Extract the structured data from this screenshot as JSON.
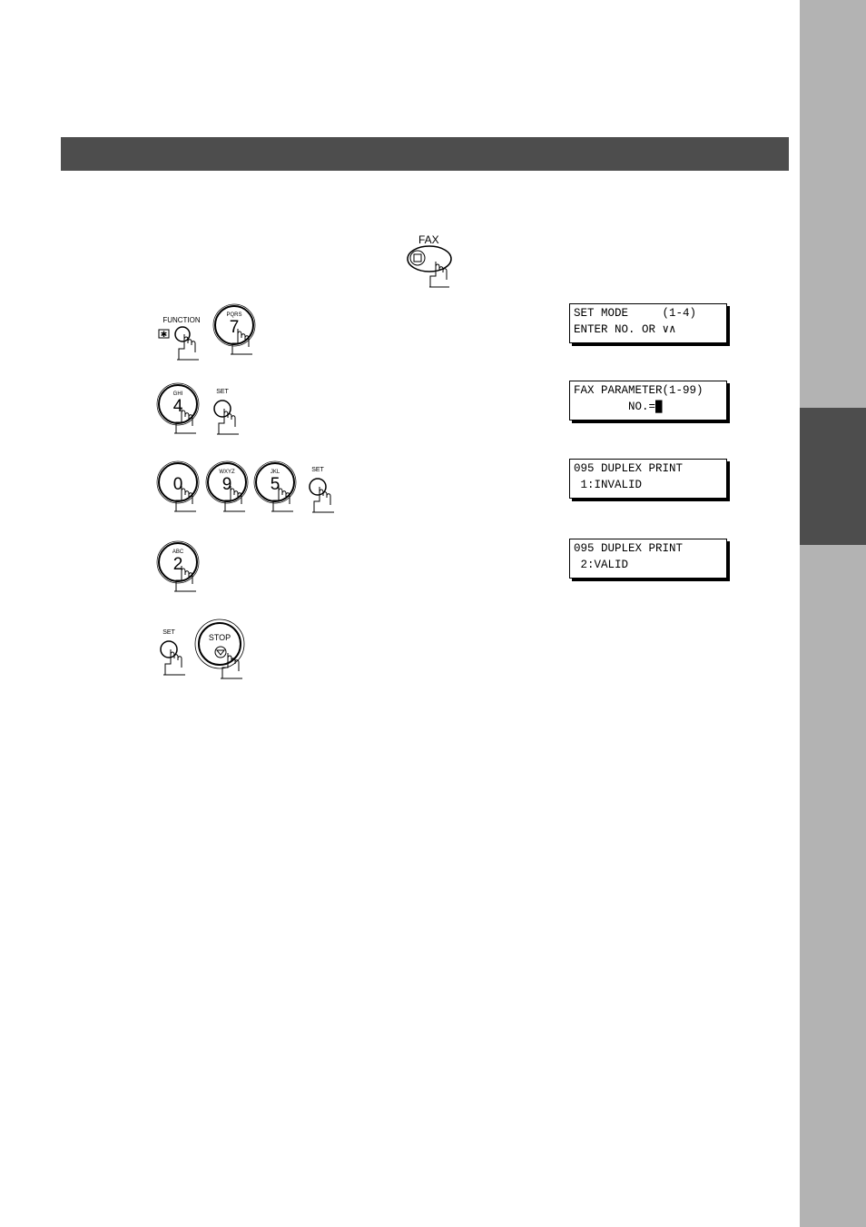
{
  "header": {
    "title": ""
  },
  "keys": {
    "fax": {
      "label": "FAX"
    },
    "function": {
      "label": "FUNCTION",
      "star": "✱"
    },
    "k7": {
      "digit": "7",
      "letters": "PQRS"
    },
    "k4": {
      "digit": "4",
      "letters": "GHI"
    },
    "set": {
      "label": "SET"
    },
    "k0": {
      "digit": "0",
      "letters": ""
    },
    "k9": {
      "digit": "9",
      "letters": "WXYZ"
    },
    "k5": {
      "digit": "5",
      "letters": "JKL"
    },
    "k2": {
      "digit": "2",
      "letters": "ABC"
    },
    "stop": {
      "label": "STOP"
    }
  },
  "displays": [
    {
      "line1": "SET MODE     (1-4)",
      "line2": "ENTER NO. OR ∨∧"
    },
    {
      "line1": "FAX PARAMETER(1-99)",
      "line2": "        NO.=█"
    },
    {
      "line1": "095 DUPLEX PRINT",
      "line2": " 1:INVALID"
    },
    {
      "line1": "095 DUPLEX PRINT",
      "line2": " 2:VALID"
    }
  ]
}
